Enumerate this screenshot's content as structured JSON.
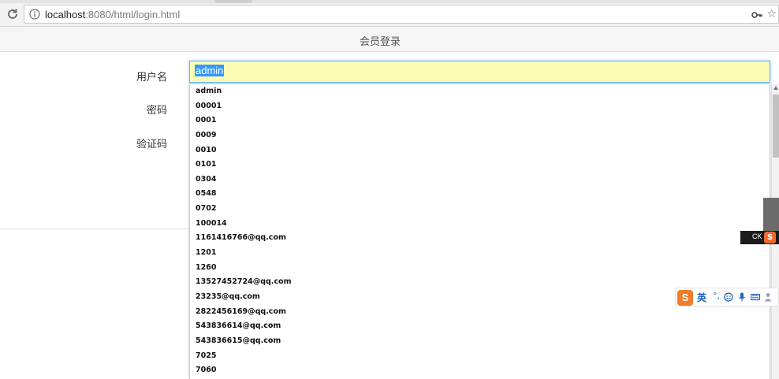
{
  "browser": {
    "url_host": "localhost",
    "url_rest": ":8080/html/login.html"
  },
  "page": {
    "title": "会员登录"
  },
  "form": {
    "username_label": "用户名",
    "password_label": "密码",
    "captcha_label": "验证码",
    "username_value": "admin"
  },
  "autocomplete": {
    "items": [
      "admin",
      "00001",
      "0001",
      "0009",
      "0010",
      "0101",
      "0304",
      "0548",
      "0702",
      "100014",
      "1161416766@qq.com",
      "1201",
      "1260",
      "13527452724@qq.com",
      "23235@qq.com",
      "2822456169@qq.com",
      "543836614@qq.com",
      "543836615@qq.com",
      "7025",
      "7060"
    ]
  },
  "ime": {
    "mini_text": "CK",
    "mini_logo": "S",
    "logo": "S",
    "lang": "英",
    "punct": "°,"
  },
  "colors": {
    "autofill_bg": "#fafcb6",
    "focus_border": "#66afe9",
    "selection": "#3399ff",
    "ime_orange": "#f07c2a",
    "ime_blue": "#1f5fbf"
  }
}
